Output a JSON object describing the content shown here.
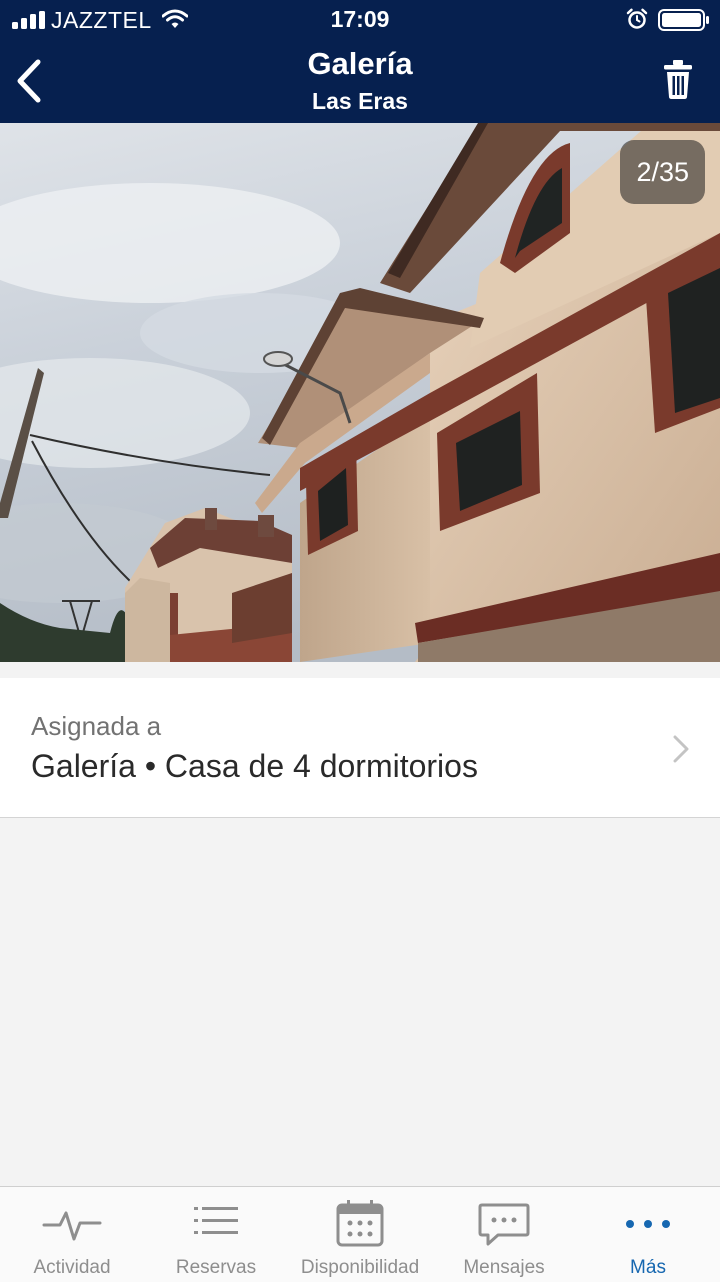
{
  "status_bar": {
    "carrier": "JAZZTEL",
    "time": "17:09"
  },
  "nav": {
    "title": "Galería",
    "subtitle": "Las Eras"
  },
  "photo": {
    "counter": "2/35"
  },
  "assignment": {
    "label": "Asignada a",
    "value": "Galería • Casa de 4 dormitorios"
  },
  "tabs": [
    {
      "label": "Actividad",
      "icon": "activity-icon",
      "active": false
    },
    {
      "label": "Reservas",
      "icon": "list-icon",
      "active": false
    },
    {
      "label": "Disponibilidad",
      "icon": "calendar-icon",
      "active": false
    },
    {
      "label": "Mensajes",
      "icon": "message-icon",
      "active": false
    },
    {
      "label": "Más",
      "icon": "more-icon",
      "active": true
    }
  ],
  "colors": {
    "header_background": "#06204f",
    "active_tab": "#1667b0",
    "inactive_tab": "#8e8e8e"
  }
}
